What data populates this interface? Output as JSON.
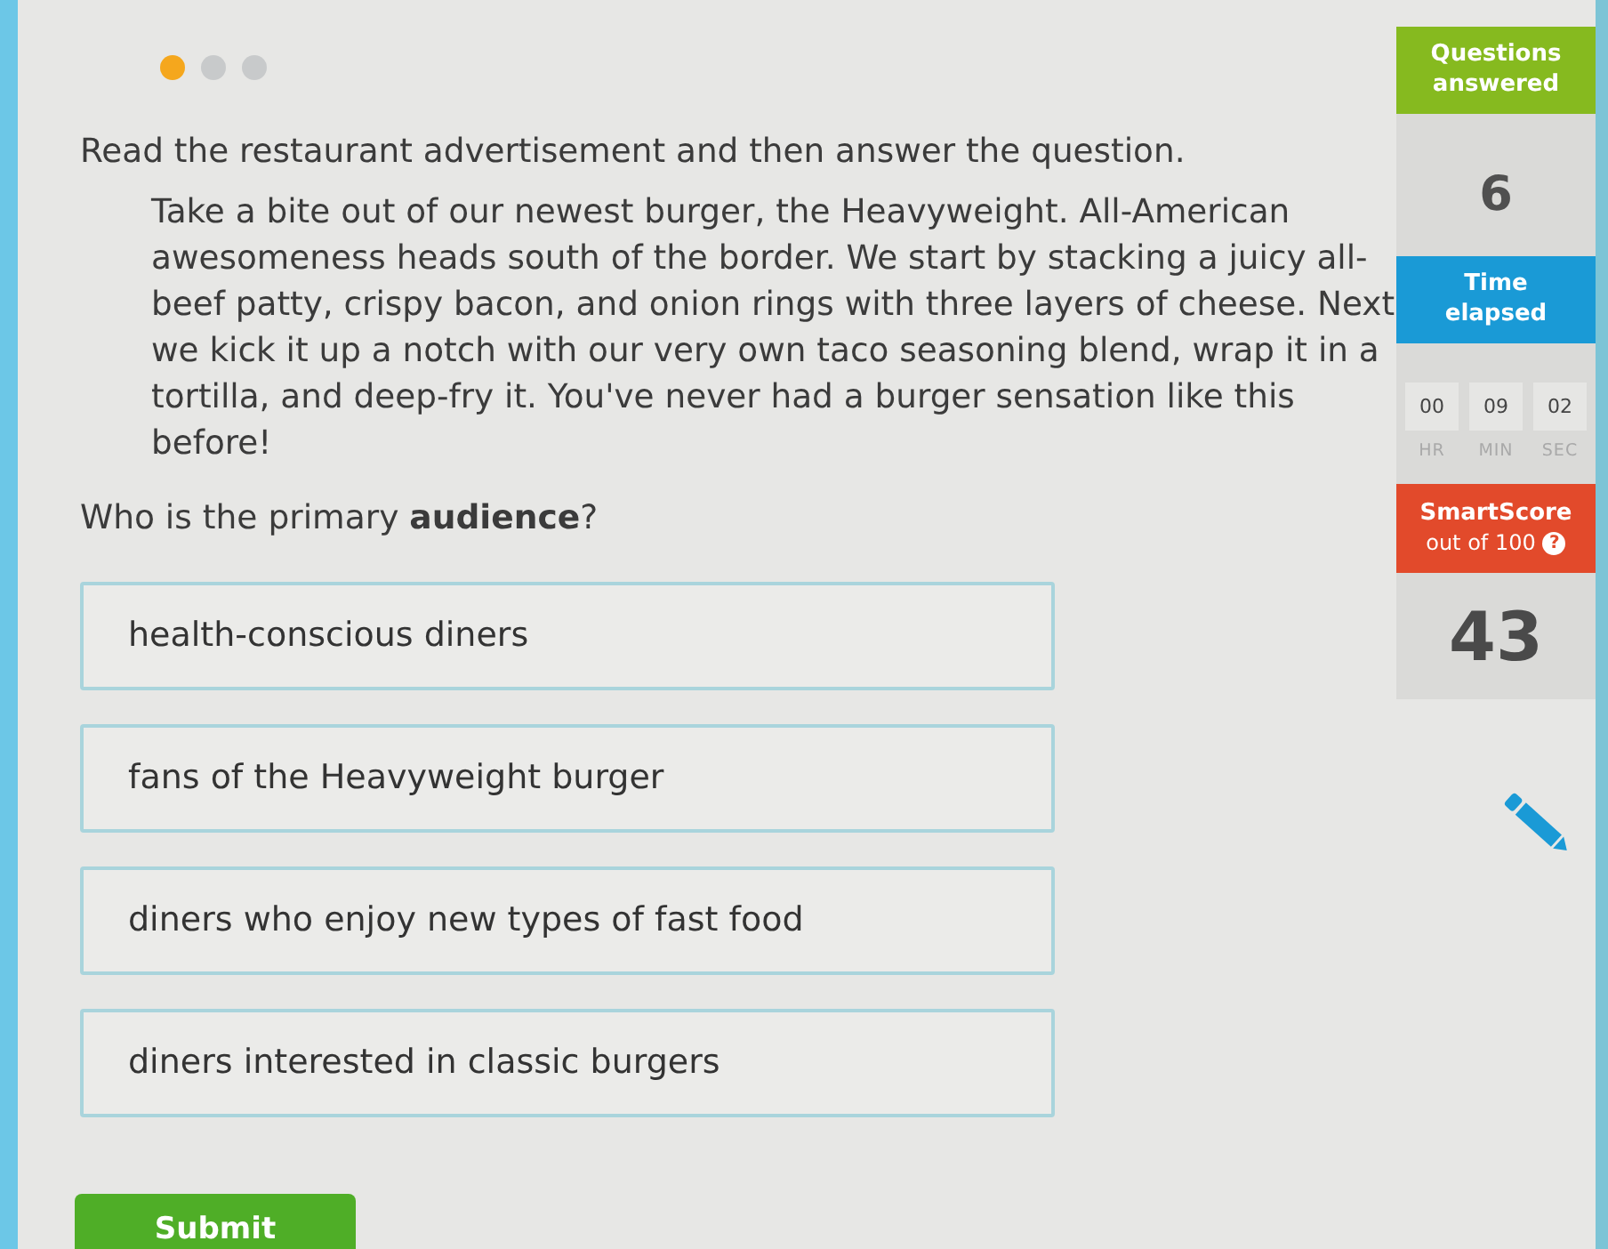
{
  "progress_dots": [
    {
      "selected": true
    },
    {
      "selected": false
    },
    {
      "selected": false
    }
  ],
  "instruction": "Read the restaurant advertisement and then answer the question.",
  "passage": "Take a bite out of our newest burger, the Heavyweight. All-American awesomeness heads south of the border. We start by stacking a juicy all-beef patty, crispy bacon, and onion rings with three layers of cheese. Next we kick it up a notch with our very own taco seasoning blend, wrap it in a tortilla, and deep-fry it. You've never had a burger sensation like this before!",
  "question": "Who is the primary **audience**?",
  "choices": [
    {
      "label": "health-conscious diners",
      "selected": false
    },
    {
      "label": "fans of the Heavyweight burger",
      "selected": false
    },
    {
      "label": "diners who enjoy new types of fast food",
      "selected": false
    },
    {
      "label": "diners interested in classic burgers",
      "selected": false
    }
  ],
  "submit_button": "Submit",
  "sidebar": {
    "questions_answered": {
      "title": "Questions answered",
      "value": "6"
    },
    "time_elapsed": {
      "title": "Time elapsed",
      "units": [
        {
          "value": "00",
          "label": "HR"
        },
        {
          "value": "09",
          "label": "MIN"
        },
        {
          "value": "02",
          "label": "SEC"
        }
      ]
    },
    "smartscore": {
      "title": "SmartScore",
      "subtitle": "out of 100",
      "help_icon": "?",
      "value": "43"
    }
  }
}
